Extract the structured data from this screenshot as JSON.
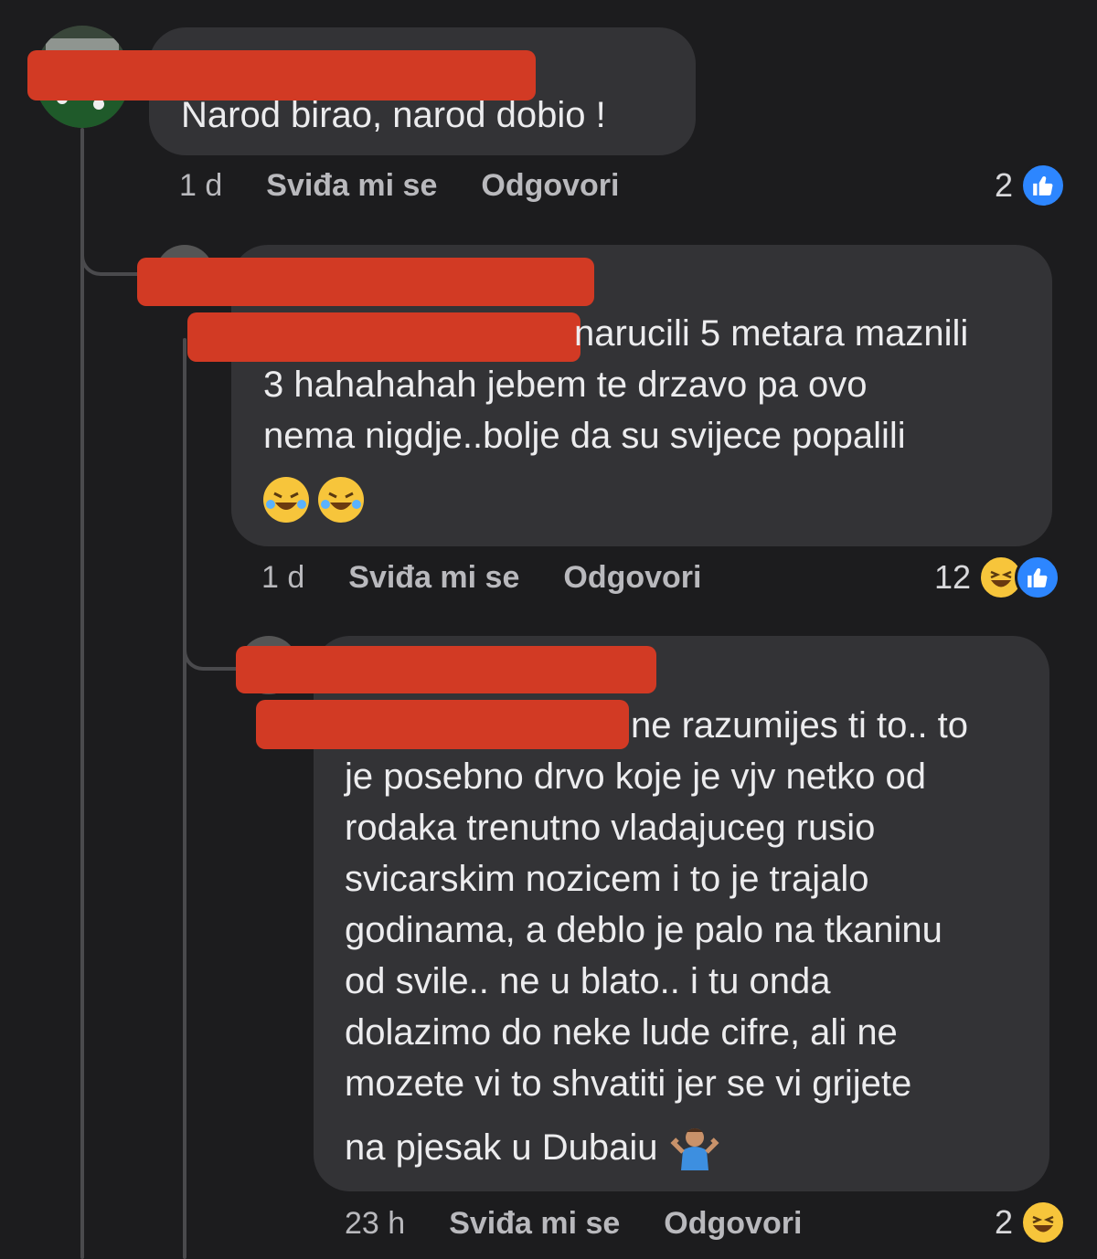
{
  "comments": [
    {
      "text": "Narod birao, narod dobio !",
      "time": "1 d",
      "like_label": "Sviđa mi se",
      "reply_label": "Odgovori",
      "reaction_count": "2",
      "reactions": [
        "like-icon"
      ]
    },
    {
      "text": "narucili 5 metara maznili\n3 hahahahah jebem te drzavo pa ovo\nnema nigdje..bolje da su svijece popalili",
      "emoji": [
        "rofl-emoji",
        "rofl-emoji"
      ],
      "time": "1 d",
      "like_label": "Sviđa mi se",
      "reply_label": "Odgovori",
      "reaction_count": "12",
      "reactions": [
        "haha-icon",
        "like-icon"
      ]
    },
    {
      "text_first": "ne razumijes ti to.. to",
      "text": "je posebno drvo koje je vjv netko od\nrodaka trenutno vladajuceg rusio\nsvicarskim nozicem i to je trajalo\ngodinama, a deblo je palo na tkaninu\nod svile.. ne u blato.. i tu onda\ndolazimo do neke lude cifre, ali ne\nmozete vi to shvatiti jer se vi grijete",
      "text_last": "na pjesak u Dubaiu",
      "emoji": [
        "shrug-emoji"
      ],
      "time": "23 h",
      "like_label": "Sviđa mi se",
      "reply_label": "Odgovori",
      "reaction_count": "2",
      "reactions": [
        "haha-icon"
      ]
    }
  ],
  "colors": {
    "background": "#1c1c1e",
    "bubble": "#333336",
    "redaction": "#d23a24",
    "like": "#2d86ff",
    "haha": "#f7c53b"
  }
}
